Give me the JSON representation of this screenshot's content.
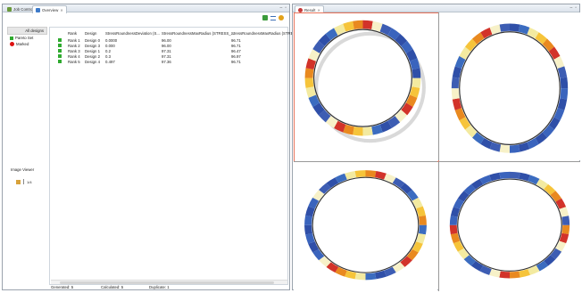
{
  "left_panel": {
    "tabs": [
      {
        "label": "Job Control",
        "active": false
      },
      {
        "label": "Overview",
        "active": true
      }
    ],
    "design_list": {
      "header": "All designs",
      "items": [
        {
          "label": "Pareto Set",
          "marker": "green-square"
        },
        {
          "label": "Marked",
          "marker": "red-dot"
        }
      ]
    },
    "image_viewer": {
      "label": "Image Viewer",
      "page_value": "1/4"
    },
    "table": {
      "columns": [
        "Rank",
        "Design",
        "StressRoundnessDeviation (S...",
        "StressRoundnessMaxRadius (STRESS_...",
        "StressRoundnessMaxRadius (STRE..."
      ],
      "rows": [
        {
          "rank": "Rank 1",
          "design": "Design 0",
          "v1": "0.0000",
          "v2": "96.00",
          "v3": "96.71"
        },
        {
          "rank": "Rank 2",
          "design": "Design 3",
          "v1": "0.000",
          "v2": "96.00",
          "v3": "96.71"
        },
        {
          "rank": "Rank 3",
          "design": "Design 1",
          "v1": "0.2",
          "v2": "97.31",
          "v3": "96.47"
        },
        {
          "rank": "Rank 4",
          "design": "Design 2",
          "v1": "0.3",
          "v2": "97.31",
          "v3": "96.97"
        },
        {
          "rank": "Rank 5",
          "design": "Design 4",
          "v1": "0.497",
          "v2": "97.36",
          "v3": "96.71"
        }
      ]
    },
    "status": {
      "generated": "Generated: 5",
      "calculated": "Calculated: 5",
      "duplicate": "Duplicate: 1"
    }
  },
  "right_panel": {
    "tabs": [
      {
        "label": "Result",
        "active": true
      }
    ],
    "images": [
      {
        "label": "result-image-1",
        "selected": true
      },
      {
        "label": "result-image-2",
        "selected": false
      },
      {
        "label": "result-image-3",
        "selected": false
      },
      {
        "label": "result-image-4",
        "selected": false
      }
    ]
  },
  "colors": {
    "selection_border": "#e8735a",
    "pareto_green": "#2faa2f",
    "marked_red": "#d11111",
    "panel_border": "#9aa3ad"
  }
}
